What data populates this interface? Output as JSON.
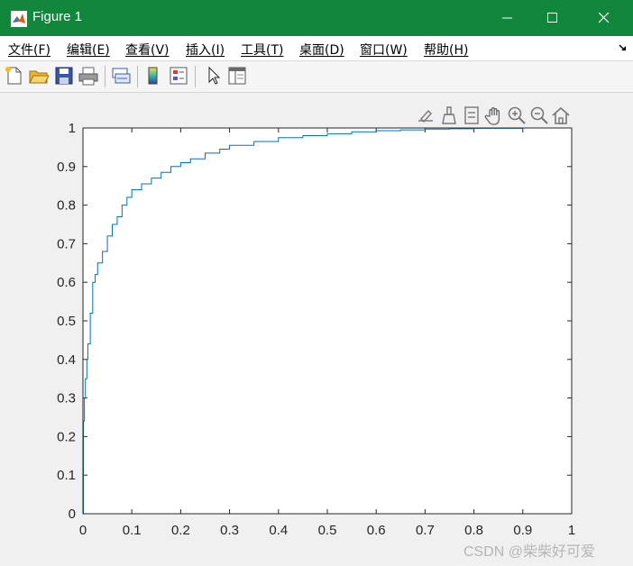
{
  "window": {
    "title": "Figure 1"
  },
  "menu": [
    "文件(F)",
    "编辑(E)",
    "查看(V)",
    "插入(I)",
    "工具(T)",
    "桌面(D)",
    "窗口(W)",
    "帮助(H)"
  ],
  "toolbar": [
    "new-figure-icon",
    "open-file-icon",
    "save-icon",
    "print-icon",
    "link-plot-icon",
    "colorbar-icon",
    "legend-icon",
    "edit-plot-icon",
    "property-inspector-icon"
  ],
  "axes_toolbar": [
    "data-tips-icon",
    "brush-icon",
    "export-icon",
    "pan-hand-icon",
    "zoom-in-icon",
    "zoom-out-icon",
    "home-icon"
  ],
  "colors": {
    "titlebar": "#10873a",
    "line": "#0072bd"
  },
  "watermark": "CSDN @柴柴好可爱",
  "chart_data": {
    "type": "line",
    "title": "",
    "xlabel": "",
    "ylabel": "",
    "xlim": [
      0,
      1
    ],
    "ylim": [
      0,
      1
    ],
    "grid": false,
    "xticks": [
      "0",
      "0.1",
      "0.2",
      "0.3",
      "0.4",
      "0.5",
      "0.6",
      "0.7",
      "0.8",
      "0.9",
      "1"
    ],
    "yticks": [
      "0",
      "0.1",
      "0.2",
      "0.3",
      "0.4",
      "0.5",
      "0.6",
      "0.7",
      "0.8",
      "0.9",
      "1"
    ],
    "series": [
      {
        "x": [
          0,
          0.001,
          0.003,
          0.005,
          0.008,
          0.01,
          0.015,
          0.02,
          0.025,
          0.03,
          0.04,
          0.05,
          0.06,
          0.07,
          0.08,
          0.09,
          0.1,
          0.12,
          0.14,
          0.16,
          0.18,
          0.2,
          0.22,
          0.25,
          0.28,
          0.3,
          0.35,
          0.4,
          0.45,
          0.5,
          0.55,
          0.6,
          0.65,
          0.7,
          0.75,
          0.8,
          0.85,
          0.9,
          0.95,
          1.0
        ],
        "y": [
          0,
          0.24,
          0.3,
          0.35,
          0.4,
          0.44,
          0.52,
          0.6,
          0.62,
          0.65,
          0.68,
          0.72,
          0.75,
          0.77,
          0.8,
          0.82,
          0.84,
          0.855,
          0.87,
          0.885,
          0.9,
          0.91,
          0.92,
          0.935,
          0.945,
          0.955,
          0.965,
          0.975,
          0.98,
          0.985,
          0.99,
          0.993,
          0.995,
          0.997,
          0.998,
          0.999,
          0.999,
          1.0,
          1.0,
          1.0
        ]
      }
    ]
  }
}
